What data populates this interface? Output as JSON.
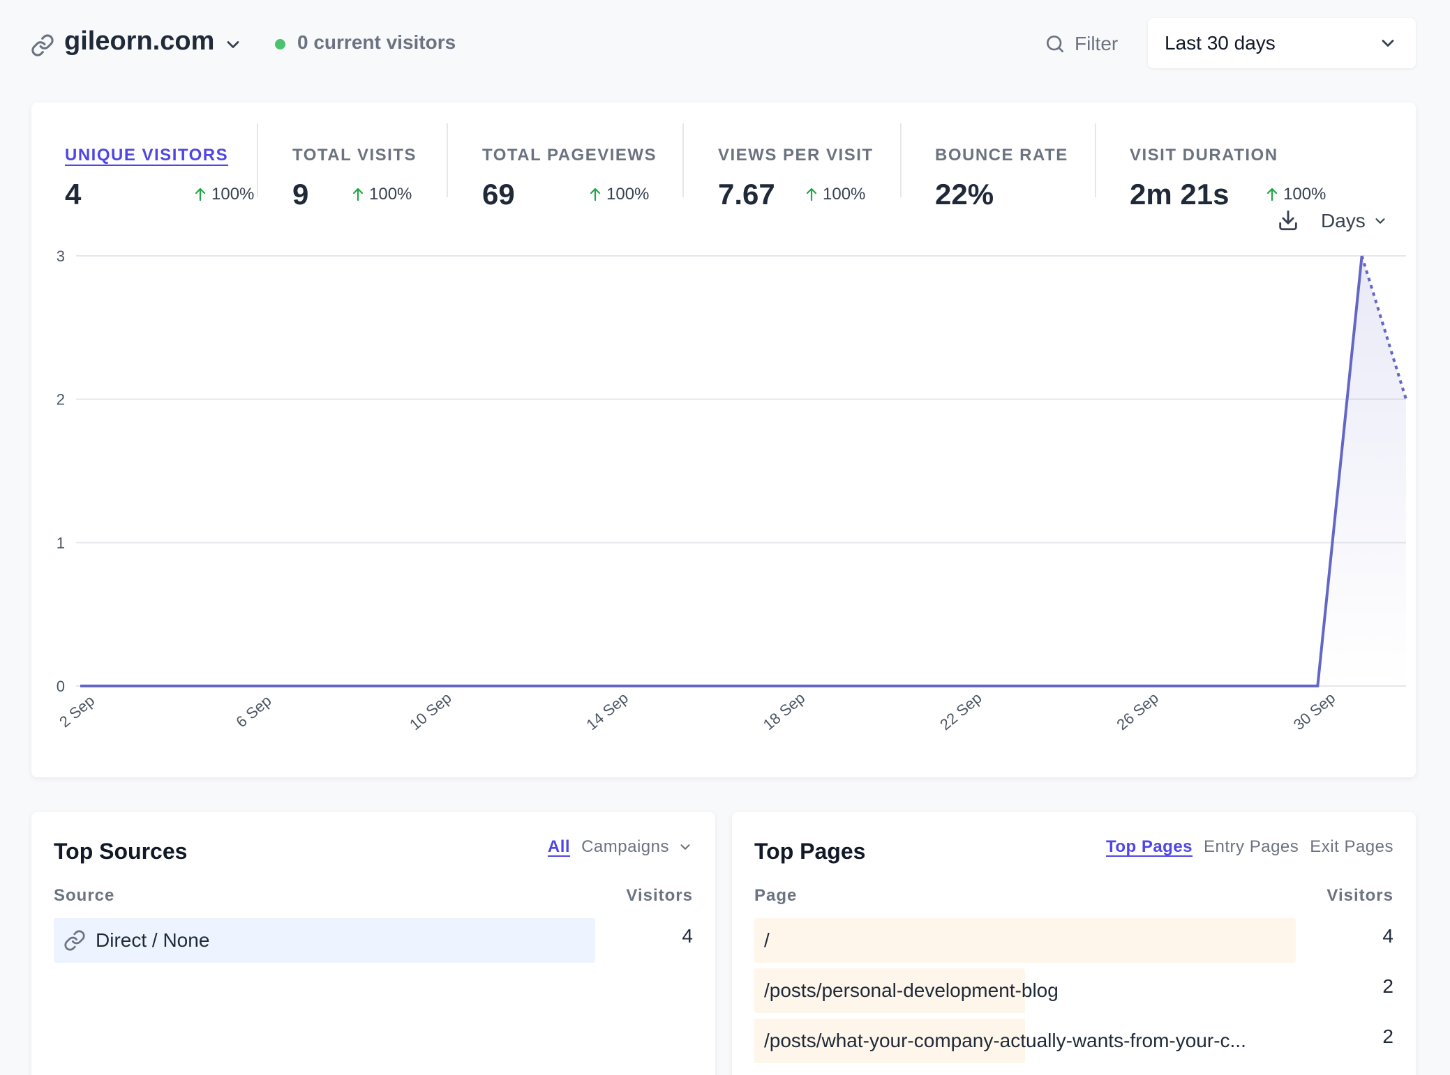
{
  "header": {
    "site_icon": "link-icon",
    "site_name": "gileorn.com",
    "current_visitors": "0 current visitors",
    "filter_label": "Filter",
    "period_label": "Last 30 days",
    "colors": {
      "live_dot": "#4bc26b",
      "accent": "#4f46e5"
    }
  },
  "metrics": [
    {
      "label": "UNIQUE VISITORS",
      "value": "4",
      "change": "100%",
      "active": true
    },
    {
      "label": "TOTAL VISITS",
      "value": "9",
      "change": "100%"
    },
    {
      "label": "TOTAL PAGEVIEWS",
      "value": "69",
      "change": "100%"
    },
    {
      "label": "VIEWS PER VISIT",
      "value": "7.67",
      "change": "100%"
    },
    {
      "label": "BOUNCE RATE",
      "value": "22%",
      "change": ""
    },
    {
      "label": "VISIT DURATION",
      "value": "2m 21s",
      "change": "100%"
    }
  ],
  "chart_controls": {
    "download_icon": "download-icon",
    "interval_label": "Days"
  },
  "chart_data": {
    "type": "line",
    "title": "",
    "xlabel": "",
    "ylabel": "",
    "x": [
      "2 Sep",
      "3 Sep",
      "4 Sep",
      "5 Sep",
      "6 Sep",
      "7 Sep",
      "8 Sep",
      "9 Sep",
      "10 Sep",
      "11 Sep",
      "12 Sep",
      "13 Sep",
      "14 Sep",
      "15 Sep",
      "16 Sep",
      "17 Sep",
      "18 Sep",
      "19 Sep",
      "20 Sep",
      "21 Sep",
      "22 Sep",
      "23 Sep",
      "24 Sep",
      "25 Sep",
      "26 Sep",
      "27 Sep",
      "28 Sep",
      "29 Sep",
      "30 Sep",
      "1 Oct",
      "2 Oct"
    ],
    "x_tick_labels": [
      "2 Sep",
      "6 Sep",
      "10 Sep",
      "14 Sep",
      "18 Sep",
      "22 Sep",
      "26 Sep",
      "30 Sep"
    ],
    "series": [
      {
        "values": [
          0,
          0,
          0,
          0,
          0,
          0,
          0,
          0,
          0,
          0,
          0,
          0,
          0,
          0,
          0,
          0,
          0,
          0,
          0,
          0,
          0,
          0,
          0,
          0,
          0,
          0,
          0,
          0,
          0,
          3,
          2
        ],
        "partial_last_point": true
      }
    ],
    "yticks": [
      0,
      1,
      2,
      3
    ],
    "ylim": [
      0,
      3
    ],
    "grid": true,
    "line_color": "#6366c6"
  },
  "top_sources": {
    "title": "Top Sources",
    "tabs": [
      "All",
      "Campaigns"
    ],
    "active_tab": "All",
    "col_source": "Source",
    "col_visitors": "Visitors",
    "rows": [
      {
        "icon": "link-icon",
        "label": "Direct / None",
        "visitors": "4",
        "fraction": 1.0
      }
    ],
    "bar_color": "#edf4ff"
  },
  "top_pages": {
    "title": "Top Pages",
    "tabs": [
      "Top Pages",
      "Entry Pages",
      "Exit Pages"
    ],
    "active_tab": "Top Pages",
    "col_page": "Page",
    "col_visitors": "Visitors",
    "rows": [
      {
        "label": "/",
        "visitors": "4",
        "fraction": 1.0
      },
      {
        "label": "/posts/personal-development-blog",
        "visitors": "2",
        "fraction": 0.5
      },
      {
        "label": "/posts/what-your-company-actually-wants-from-your-c...",
        "visitors": "2",
        "fraction": 0.5
      }
    ],
    "bar_color": "#fff6eb"
  }
}
